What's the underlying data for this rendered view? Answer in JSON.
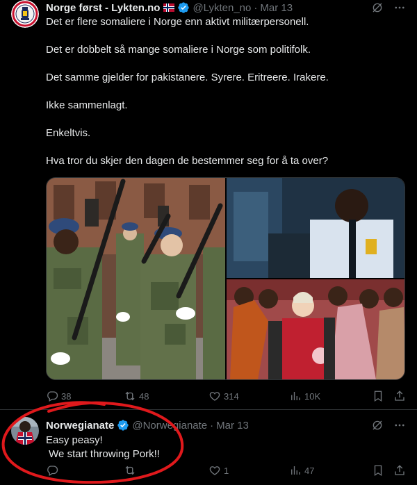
{
  "tweet1": {
    "display_name": "Norge først - Lykten.no",
    "handle": "@Lykten_no",
    "separator": "·",
    "date": "Mar 13",
    "paragraphs": [
      "Det er flere somaliere i Norge enn aktivt militærpersonell.",
      "Det er dobbelt så mange somaliere i Norge som politifolk.",
      "Det samme gjelder for pakistanere. Syrere. Eritreere. Irakere.",
      "Ikke sammenlagt.",
      "Enkeltvis.",
      "Hva tror du skjer den dagen de bestemmer seg for å ta over?"
    ],
    "stats": {
      "replies": "38",
      "reposts": "48",
      "likes": "314",
      "views": "10K"
    }
  },
  "tweet2": {
    "display_name": "Norwegianate",
    "handle": "@Norwegianate",
    "separator": "·",
    "date": "Mar 13",
    "lines": [
      "Easy peasy!",
      " We start throwing Pork!!"
    ],
    "stats": {
      "replies": "",
      "reposts": "",
      "likes": "1",
      "views": "47"
    }
  },
  "colors": {
    "background": "#000000",
    "text": "#e7e9ea",
    "muted": "#71767b",
    "verified": "#1d9bf0",
    "annotation": "#e0191c"
  },
  "icons": [
    "grok-icon",
    "more-icon",
    "reply-icon",
    "repost-icon",
    "like-icon",
    "views-icon",
    "bookmark-icon",
    "share-icon",
    "verified-icon",
    "norway-flag-icon"
  ]
}
